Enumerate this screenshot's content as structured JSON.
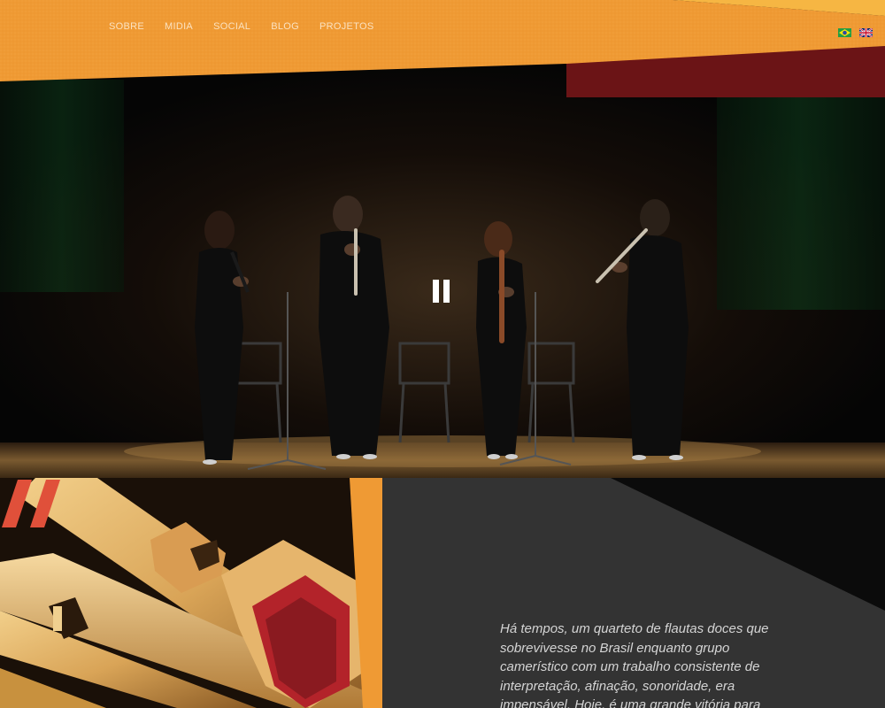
{
  "nav": {
    "items": [
      {
        "label": "SOBRE"
      },
      {
        "label": "MIDIA"
      },
      {
        "label": "SOCIAL"
      },
      {
        "label": "BLOG"
      },
      {
        "label": "PROJETOS"
      }
    ]
  },
  "languages": [
    {
      "icon": "brazil-flag-icon"
    },
    {
      "icon": "uk-flag-icon"
    }
  ],
  "hero": {
    "video_control": "pause-icon"
  },
  "quote": {
    "mark": "“",
    "text": "Há tempos, um quarteto de flautas doces que sobrevivesse no Brasil enquanto grupo camerístico com um trabalho consistente de interpretação, afinação, sonoridade, era impensável. Hoje, é uma grande vitória para"
  },
  "colors": {
    "header_orange": "#ef9a34",
    "header_yellow": "#f6b643",
    "header_maroon": "#6b1416",
    "quote_panel": "#333333",
    "quote_accent": "#e0503a",
    "text_light": "#d4d4d4"
  }
}
